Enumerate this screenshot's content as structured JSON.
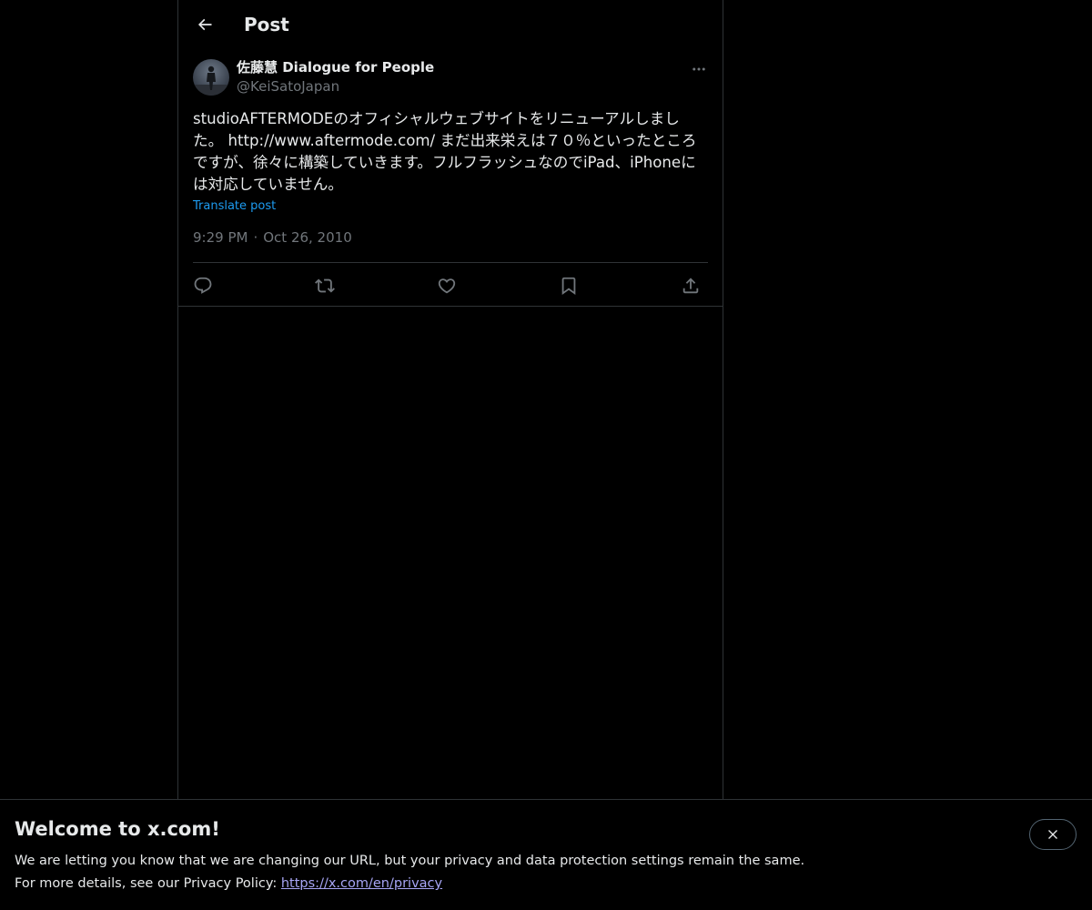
{
  "header": {
    "title": "Post"
  },
  "post": {
    "author": {
      "display_name": "佐藤慧 Dialogue for People",
      "handle": "@KeiSatoJapan"
    },
    "text_before_link": "studioAFTERMODEのオフィシャルウェブサイトをリニューアルしました。 ",
    "link": "http://www.aftermode.com/",
    "text_after_link": " まだ出来栄えは７０％といったところですが、徐々に構築していきます。フルフラッシュなのでiPad、iPhoneには対応していません。",
    "translate_label": "Translate post",
    "time": "9:29 PM",
    "separator": "·",
    "date": "Oct 26, 2010"
  },
  "banner": {
    "title": "Welcome to x.com!",
    "line1": "We are letting you know that we are changing our URL, but your privacy and data protection settings remain the same.",
    "line2_prefix": "For more details, see our Privacy Policy: ",
    "privacy_link": "https://x.com/en/privacy"
  },
  "icons": {
    "back": "arrow-left-icon",
    "more": "more-horizontal-icon",
    "reply": "reply-icon",
    "repost": "repost-icon",
    "like": "heart-icon",
    "bookmark": "bookmark-icon",
    "share": "share-icon",
    "close": "close-icon"
  },
  "colors": {
    "background": "#000000",
    "text": "#e7e9ea",
    "secondary_text": "#71767b",
    "accent": "#1d9bf0",
    "border": "#2f3336",
    "privacy_link": "#a7a5f5"
  }
}
